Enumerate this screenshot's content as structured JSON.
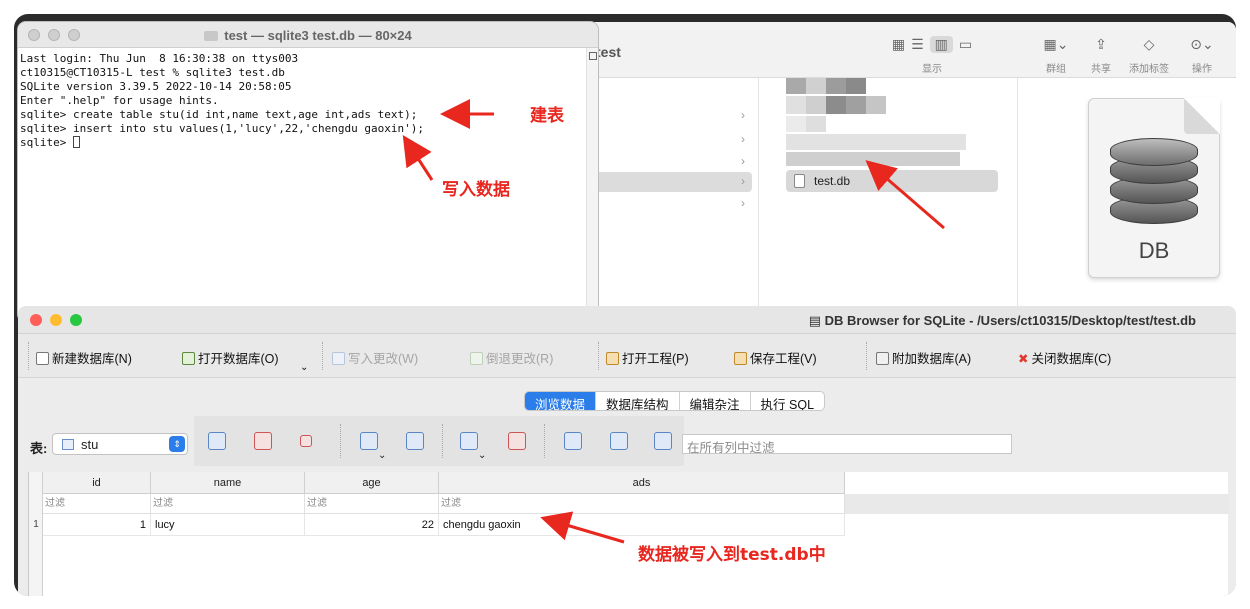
{
  "terminal": {
    "title": "test — sqlite3 test.db — 80×24",
    "lines": [
      "Last login: Thu Jun  8 16:30:38 on ttys003",
      "ct10315@CT10315-L test % sqlite3 test.db",
      "SQLite version 3.39.5 2022-10-14 20:58:05",
      "Enter \".help\" for usage hints.",
      "sqlite> create table stu(id int,name text,age int,ads text);",
      "sqlite> insert into stu values(1,'lucy',22,'chengdu gaoxin');",
      "sqlite> "
    ]
  },
  "finder": {
    "title": "test",
    "toolbar": {
      "display_label": "显示",
      "group_label": "群组",
      "share_label": "共享",
      "tag_label": "添加标签",
      "action_label": "操作"
    },
    "selected_file": "test.db",
    "preview_label": "DB"
  },
  "dbbrowser": {
    "title": "DB Browser for SQLite - /Users/ct10315/Desktop/test/test.db",
    "toolbar": {
      "new_db": "新建数据库(N)",
      "open_db": "打开数据库(O)",
      "write_changes": "写入更改(W)",
      "revert_changes": "倒退更改(R)",
      "open_project": "打开工程(P)",
      "save_project": "保存工程(V)",
      "attach_db": "附加数据库(A)",
      "close_db": "关闭数据库(C)"
    },
    "tabs": [
      "浏览数据",
      "数据库结构",
      "编辑杂注",
      "执行 SQL"
    ],
    "active_tab": "浏览数据",
    "table_label": "表:",
    "table_selected": "stu",
    "filter_all_placeholder": "在所有列中过滤",
    "columns": [
      "id",
      "name",
      "age",
      "ads"
    ],
    "filter_placeholder": "过滤",
    "rows": [
      {
        "rownum": "1",
        "id": "1",
        "name": "lucy",
        "age": "22",
        "ads": "chengdu gaoxin"
      }
    ]
  },
  "annotations": {
    "create_table": "建表",
    "insert_data": "写入数据",
    "written_to_db": "数据被写入到test.db中"
  },
  "colors": {
    "annotation": "#e8271f",
    "accent_tab": "#2b7de9",
    "close_red": "#ff5f57",
    "minimize_yellow": "#febc2e",
    "zoom_green": "#28c840"
  }
}
